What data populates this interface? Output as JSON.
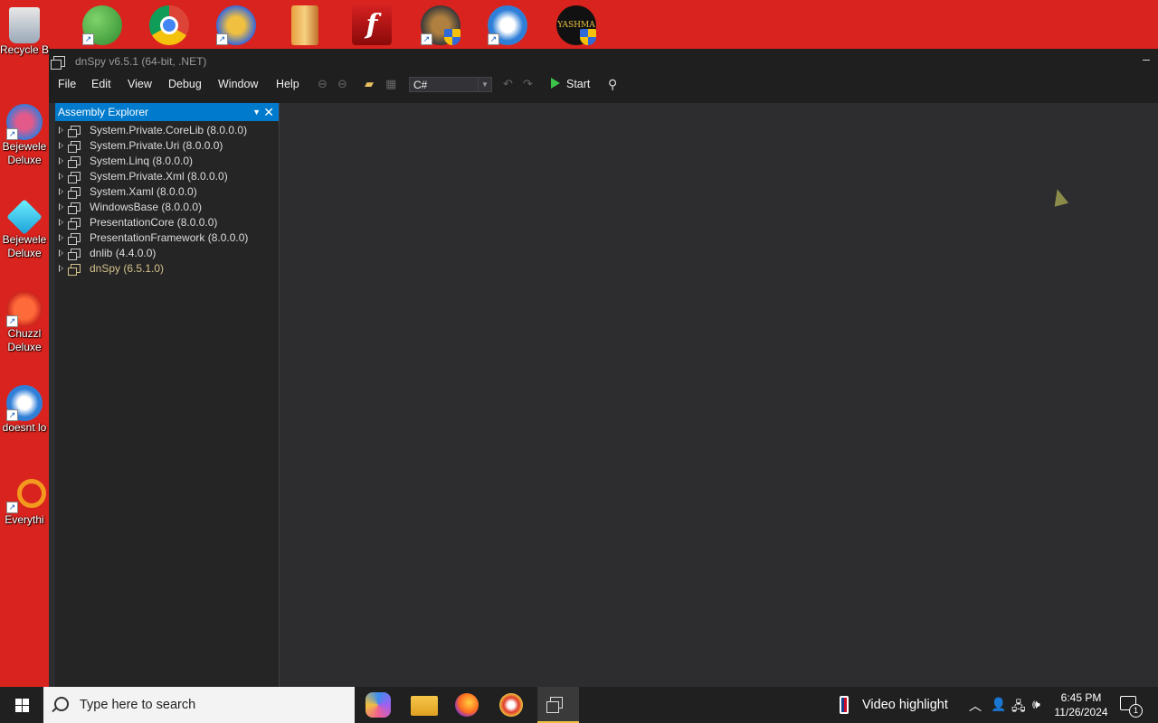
{
  "desktop": {
    "left_icons": [
      {
        "label": "Recycle B"
      },
      {
        "label": "Bejewele Deluxe"
      },
      {
        "label": "Bejewele Deluxe"
      },
      {
        "label": "Chuzzl Deluxe"
      },
      {
        "label": "doesnt lo"
      },
      {
        "label": "Everythi"
      }
    ],
    "top_icon_names": [
      "messenger-icon",
      "chrome-icon",
      "p-app-icon",
      "archive-app-icon",
      "flash-icon",
      "shield-app-icon",
      "thunderbird-icon",
      "yashma-icon"
    ],
    "yashma_label": "YASHMA"
  },
  "window": {
    "title": "dnSpy v6.5.1 (64-bit, .NET)",
    "minimize_glyph": "–"
  },
  "menubar": {
    "items": [
      "File",
      "Edit",
      "View",
      "Debug",
      "Window",
      "Help"
    ],
    "language": "C#",
    "start_label": "Start"
  },
  "explorer": {
    "title": "Assembly Explorer",
    "items": [
      {
        "label": "System.Private.CoreLib (8.0.0.0)"
      },
      {
        "label": "System.Private.Uri (8.0.0.0)"
      },
      {
        "label": "System.Linq (8.0.0.0)"
      },
      {
        "label": "System.Private.Xml (8.0.0.0)"
      },
      {
        "label": "System.Xaml (8.0.0.0)"
      },
      {
        "label": "WindowsBase (8.0.0.0)"
      },
      {
        "label": "PresentationCore (8.0.0.0)"
      },
      {
        "label": "PresentationFramework (8.0.0.0)"
      },
      {
        "label": "dnlib (4.4.0.0)"
      },
      {
        "label": "dnSpy (6.5.1.0)"
      }
    ]
  },
  "taskbar": {
    "search_placeholder": "Type here to search",
    "news_text": "Video highlight",
    "time": "6:45 PM",
    "date": "11/26/2024",
    "notification_count": "1"
  },
  "colors": {
    "desktop_bg": "#d9231e",
    "accent": "#007acc",
    "window_bg": "#2d2d30",
    "taskbar_bg": "#202020"
  }
}
